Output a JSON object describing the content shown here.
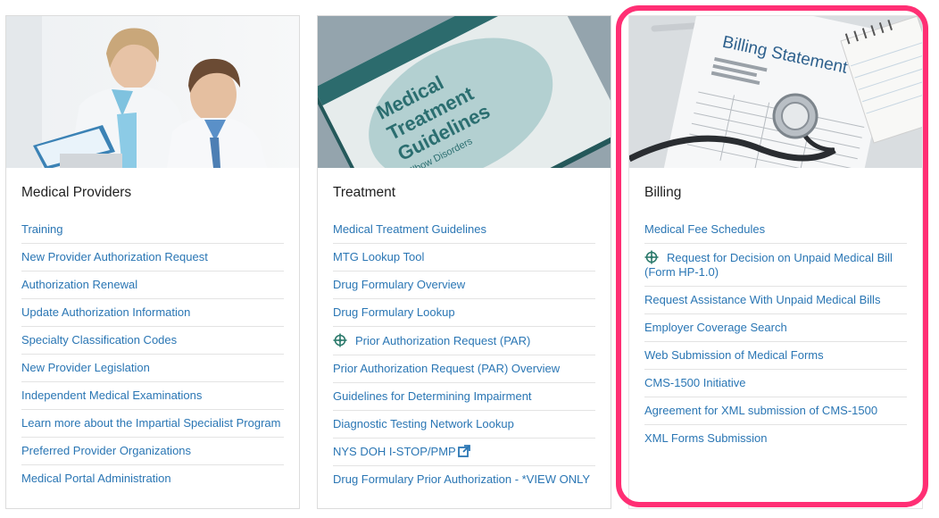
{
  "colors": {
    "link": "#2a76b4",
    "title": "#1f1f1f",
    "highlight": "#ff2f74",
    "divider": "#e3e3e3"
  },
  "cards": [
    {
      "title": "Medical Providers",
      "links": [
        {
          "label": "Training"
        },
        {
          "label": "New Provider Authorization Request"
        },
        {
          "label": "Authorization Renewal"
        },
        {
          "label": "Update Authorization Information"
        },
        {
          "label": "Specialty Classification Codes"
        },
        {
          "label": "New Provider Legislation"
        },
        {
          "label": "Independent Medical Examinations"
        },
        {
          "label": "Learn more about the Impartial Specialist Program"
        },
        {
          "label": "Preferred Provider Organizations"
        },
        {
          "label": "Medical Portal Administration"
        }
      ]
    },
    {
      "title": "Treatment",
      "image_text": {
        "line1": "Medical",
        "line2": "Treatment",
        "line3": "Guidelines",
        "line4": "Elbow Disorders"
      },
      "links": [
        {
          "label": "Medical Treatment Guidelines"
        },
        {
          "label": "MTG Lookup Tool"
        },
        {
          "label": "Drug Formulary Overview"
        },
        {
          "label": "Drug Formulary Lookup"
        },
        {
          "label": "Prior Authorization Request (PAR)",
          "icon": "crosshair-icon"
        },
        {
          "label": "Prior Authorization Request (PAR) Overview"
        },
        {
          "label": "Guidelines for Determining Impairment"
        },
        {
          "label": "Diagnostic Testing Network Lookup"
        },
        {
          "label": "NYS DOH I-STOP/PMP",
          "icon": "external-link-icon"
        },
        {
          "label": "Drug Formulary Prior Authorization - *VIEW ONLY"
        }
      ]
    },
    {
      "title": "Billing",
      "image_text": {
        "heading": "Billing Statement"
      },
      "links": [
        {
          "label": "Medical Fee Schedules"
        },
        {
          "label": "Request for Decision on Unpaid Medical Bill (Form HP-1.0)",
          "icon": "crosshair-icon"
        },
        {
          "label": "Request Assistance With Unpaid Medical Bills"
        },
        {
          "label": "Employer Coverage Search"
        },
        {
          "label": "Web Submission of Medical Forms"
        },
        {
          "label": "CMS-1500 Initiative"
        },
        {
          "label": "Agreement for XML submission of CMS-1500"
        },
        {
          "label": "XML Forms Submission"
        }
      ]
    }
  ]
}
